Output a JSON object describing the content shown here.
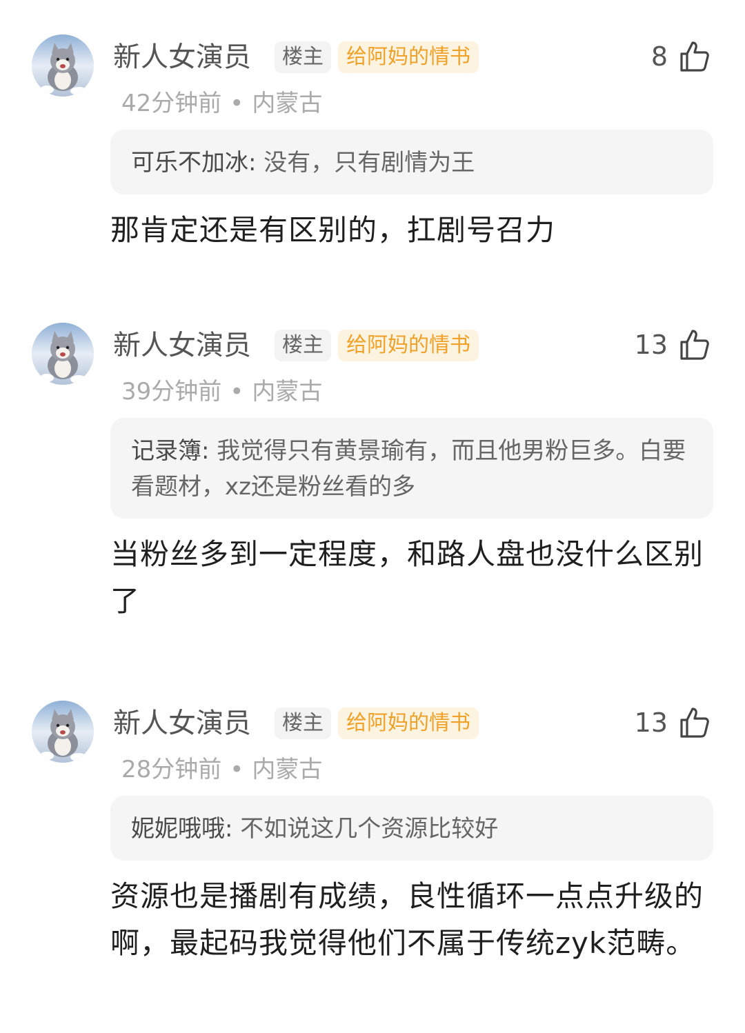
{
  "comments": [
    {
      "username": "新人女演员",
      "host_tag": "楼主",
      "fan_tag": "给阿妈的情书",
      "like_count": "8",
      "time": "42分钟前",
      "separator": "•",
      "location": "内蒙古",
      "quote_name": "可乐不加冰:",
      "quote_text": " 没有，只有剧情为王",
      "body": "那肯定还是有区别的，扛剧号召力"
    },
    {
      "username": "新人女演员",
      "host_tag": "楼主",
      "fan_tag": "给阿妈的情书",
      "like_count": "13",
      "time": "39分钟前",
      "separator": "•",
      "location": "内蒙古",
      "quote_name": "记录簿:",
      "quote_text": " 我觉得只有黄景瑜有，而且他男粉巨多。白要看题材，xz还是粉丝看的多",
      "body": "当粉丝多到一定程度，和路人盘也没什么区别了"
    },
    {
      "username": "新人女演员",
      "host_tag": "楼主",
      "fan_tag": "给阿妈的情书",
      "like_count": "13",
      "time": "28分钟前",
      "separator": "•",
      "location": "内蒙古",
      "quote_name": "妮妮哦哦:",
      "quote_text": " 不如说这几个资源比较好",
      "body": "资源也是播剧有成绩，良性循环一点点升级的啊，最起码我觉得他们不属于传统zyk范畴。"
    }
  ],
  "icons": {
    "avatar": "cat-avatar-icon",
    "like": "thumbs-up-icon"
  },
  "colors": {
    "fan_tag_text": "#f0a128",
    "fan_tag_bg": "#fdf3e1",
    "host_tag_bg": "#f3f3f3",
    "quote_bg": "#f5f5f5",
    "meta_text": "#aaaaaa"
  }
}
